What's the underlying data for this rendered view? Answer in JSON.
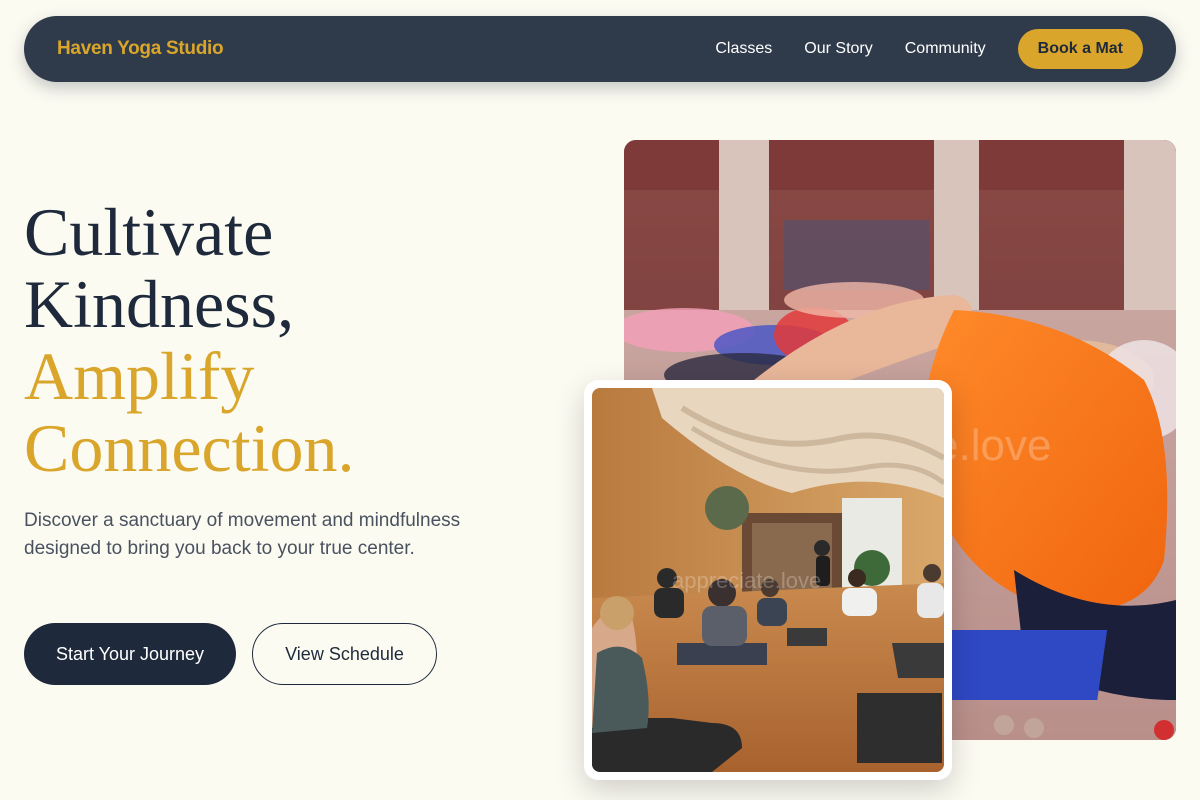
{
  "nav": {
    "brand": "Haven Yoga Studio",
    "links": [
      "Classes",
      "Our Story",
      "Community"
    ],
    "cta": "Book a Mat"
  },
  "hero": {
    "title_line1": "Cultivate",
    "title_line2": "Kindness,",
    "title_line3": "Amplify",
    "title_line4": "Connection.",
    "subtitle": "Discover a sanctuary of movement and mindfulness designed to bring you back to your true center.",
    "primary_button": "Start Your Journey",
    "secondary_button": "View Schedule"
  },
  "images": {
    "large_alt": "Yoga class stretching in a large hall, man in orange shirt in foreground",
    "small_alt": "Students seated on mats in a warm wooden yoga studio with draped ceiling"
  },
  "colors": {
    "background": "#fcfbf2",
    "navy": "#1e2a3b",
    "nav_bg": "#2f3a4b",
    "gold": "#d9a62b"
  }
}
